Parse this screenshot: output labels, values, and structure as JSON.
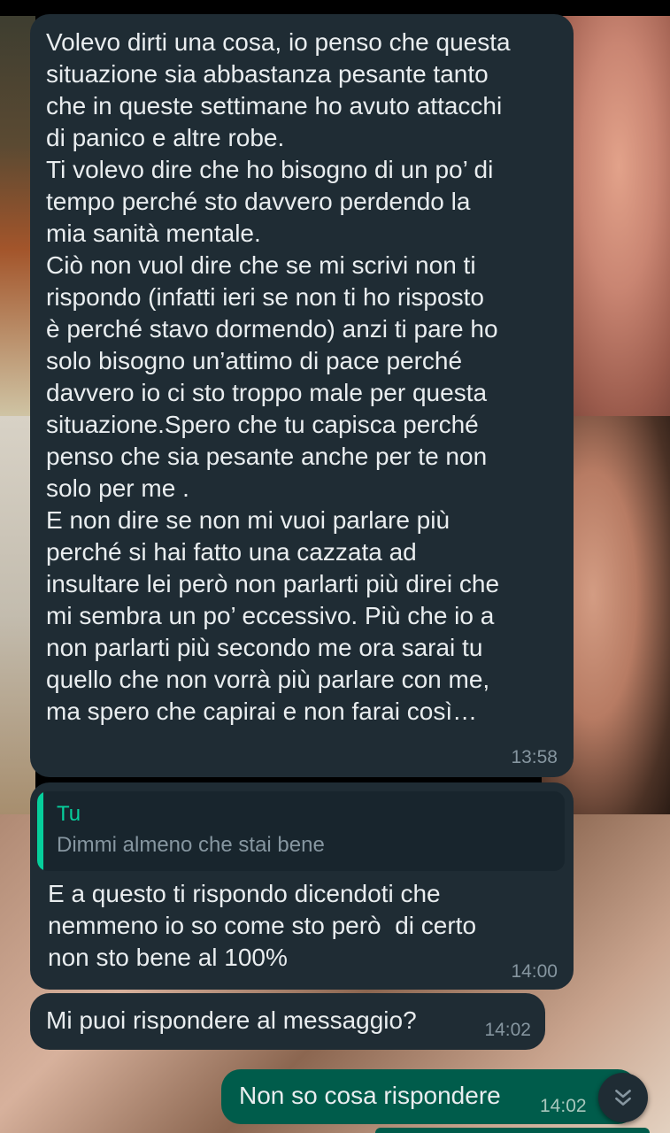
{
  "messages": [
    {
      "text": "Volevo dirti una cosa, io penso che questa\nsituazione sia abbastanza pesante tanto\nche in queste settimane ho avuto attacchi\ndi panico e altre robe.\nTi volevo dire che ho bisogno di un po’ di\ntempo perché sto davvero perdendo la\nmia sanità mentale.\nCiò non vuol dire che se mi scrivi non ti\nrispondo (infatti ieri se non ti ho risposto\nè perché stavo dormendo) anzi ti pare ho\nsolo bisogno un’attimo di pace perché\ndavvero io ci sto troppo male per questa\nsituazione.Spero che tu capisca perché\npenso che sia pesante anche per te non\nsolo per me .\nE non dire se non mi vuoi parlare più\nperché si hai fatto una cazzata ad\ninsultare lei però non parlarti più direi che\nmi sembra un po’ eccessivo. Più che io a\nnon parlarti più secondo me ora sarai tu\nquello che non vorrà più parlare con me,\nma spero che capirai e non farai così…",
      "time": "13:58"
    },
    {
      "quote_author": "Tu",
      "quote_text": "Dimmi almeno che stai bene",
      "text": "E a questo ti rispondo dicendoti che\nnemmeno io so come sto però  di certo\nnon sto bene al 100%",
      "time": "14:00"
    },
    {
      "text": "Mi puoi rispondere al messaggio?",
      "time": "14:02"
    },
    {
      "text": "Non so cosa rispondere",
      "time": "14:02"
    }
  ],
  "scroll_button": {
    "icon": "double-chevron-down-icon"
  },
  "colors": {
    "incoming_bubble": "#1f2c34",
    "outgoing_bubble": "#005c4b",
    "quote_accent": "#06cf9c",
    "timestamp": "#8696a0"
  }
}
